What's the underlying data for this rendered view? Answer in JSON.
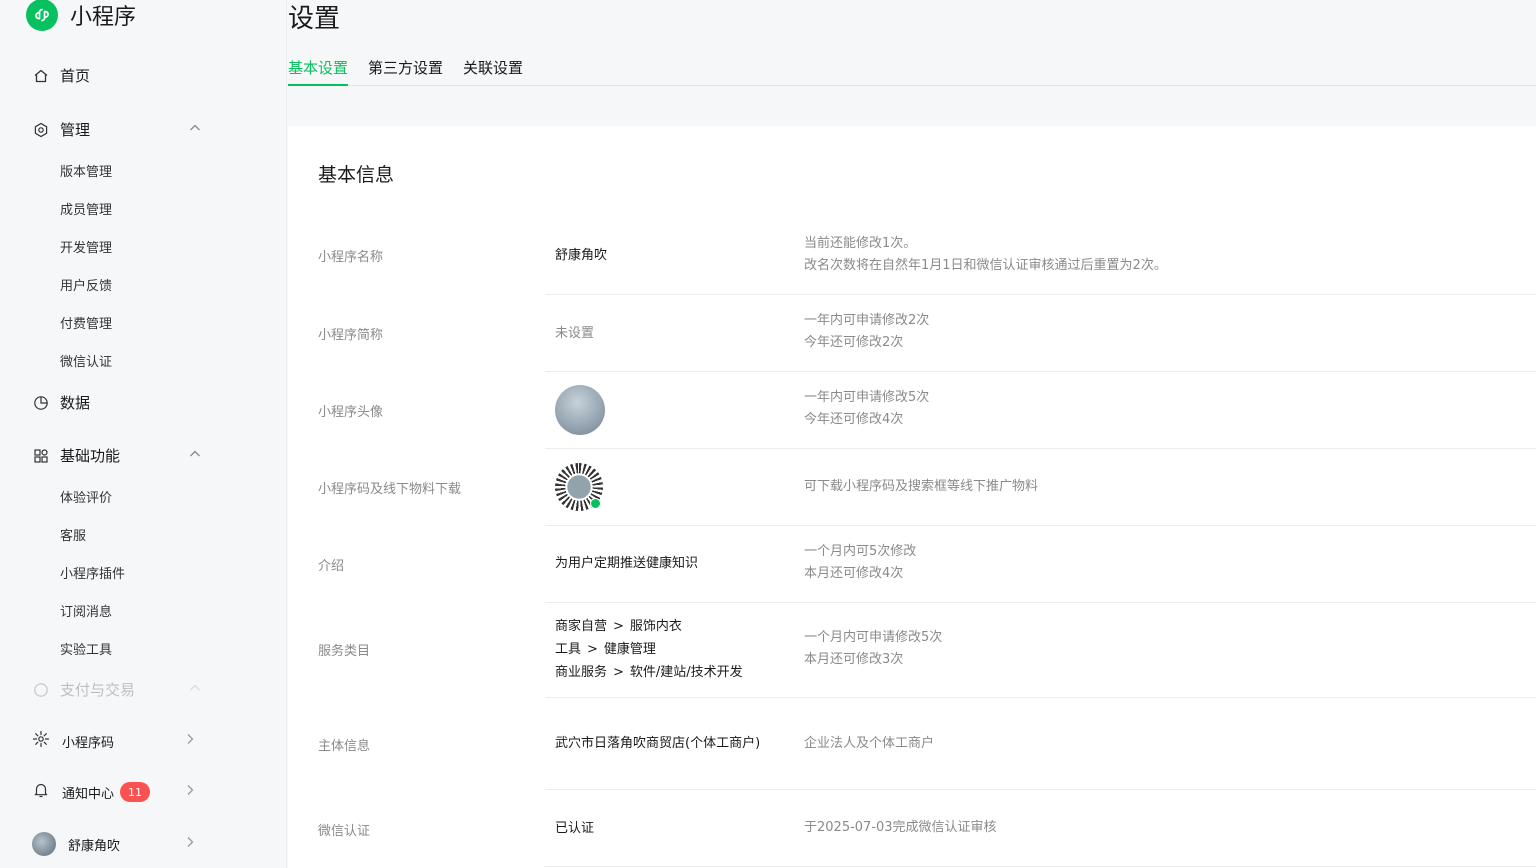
{
  "brand": {
    "name": "小程序"
  },
  "sidebar": {
    "home": "首页",
    "manage": {
      "label": "管理",
      "items": [
        "版本管理",
        "成员管理",
        "开发管理",
        "用户反馈",
        "付费管理",
        "微信认证"
      ]
    },
    "data": "数据",
    "basic": {
      "label": "基础功能",
      "items": [
        "体验评价",
        "客服",
        "小程序插件",
        "订阅消息",
        "实验工具"
      ]
    },
    "pay": "支付与交易",
    "qrcode": "小程序码",
    "notify": {
      "label": "通知中心",
      "badge": "11"
    },
    "account": "舒康角吹"
  },
  "page": {
    "title": "设置",
    "tabs": [
      "基本设置",
      "第三方设置",
      "关联设置"
    ],
    "active_tab": "基本设置"
  },
  "card": {
    "title": "基本信息",
    "rows": {
      "name": {
        "label": "小程序名称",
        "value": "舒康角吹",
        "hint1": "当前还能修改1次。",
        "hint2": "改名次数将在自然年1月1日和微信认证审核通过后重置为2次。"
      },
      "short": {
        "label": "小程序简称",
        "value": "未设置",
        "hint1": "一年内可申请修改2次",
        "hint2": "今年还可修改2次"
      },
      "avatar": {
        "label": "小程序头像",
        "hint1": "一年内可申请修改5次",
        "hint2": "今年还可修改4次"
      },
      "code": {
        "label": "小程序码及线下物料下载",
        "hint1": "可下载小程序码及搜索框等线下推广物料"
      },
      "intro": {
        "label": "介绍",
        "value": "为用户定期推送健康知识",
        "hint1": "一个月内可5次修改",
        "hint2": "本月还可修改4次"
      },
      "category": {
        "label": "服务类目",
        "cats": [
          {
            "a": "商家自营",
            "b": "服饰内衣"
          },
          {
            "a": "工具",
            "b": "健康管理"
          },
          {
            "a": "商业服务",
            "b": "软件/建站/技术开发"
          }
        ],
        "sep": ">",
        "hint1": "一个月内可申请修改5次",
        "hint2": "本月还可修改3次"
      },
      "subject": {
        "label": "主体信息",
        "value": "武穴市日落角吹商贸店(个体工商户)",
        "hint1": "企业法人及个体工商户"
      },
      "wechat": {
        "label": "微信认证",
        "value": "已认证",
        "hint1": "于2025-07-03完成微信认证审核"
      }
    }
  },
  "colors": {
    "accent": "#07c160",
    "badge": "#fa5151"
  },
  "icons": [
    "miniprogram-logo-icon",
    "home-icon",
    "manage-icon",
    "data-icon",
    "grid-icon",
    "sparkle-icon",
    "bell-icon",
    "chevron-up-icon",
    "chevron-right-icon"
  ]
}
